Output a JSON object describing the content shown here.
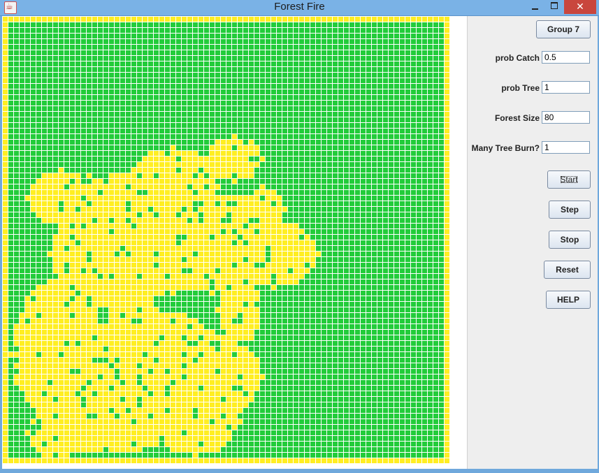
{
  "window": {
    "title": "Forest Fire",
    "close_glyph": "✕"
  },
  "controls": {
    "group_label": "Group 7",
    "prob_catch_label": "prob Catch",
    "prob_catch_value": "0.5",
    "prob_tree_label": "prob Tree",
    "prob_tree_value": "1",
    "forest_size_label": "Forest Size",
    "forest_size_value": "80",
    "many_tree_label": "Many Tree Burn?",
    "many_tree_value": "1",
    "start_label": "Start",
    "step_label": "Step",
    "stop_label": "Stop",
    "reset_label": "Reset",
    "help_label": "HELP"
  },
  "grid": {
    "size": 80,
    "colors": {
      "tree": "#22cc3a",
      "empty": "#ffee22",
      "line": "#ffffff"
    }
  }
}
